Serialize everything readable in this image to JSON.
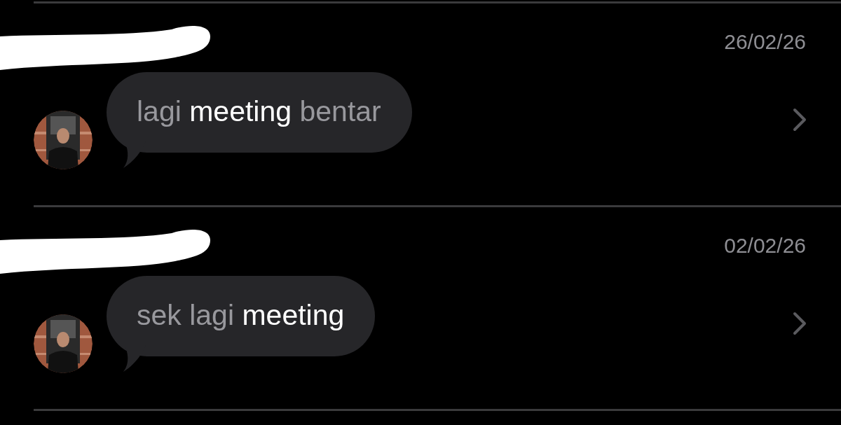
{
  "results": [
    {
      "sender_redacted": true,
      "date": "26/02/26",
      "message": "lagi **meeting** bentar"
    },
    {
      "sender_redacted": true,
      "date": "02/02/26",
      "message": "sek lagi **meeting**"
    }
  ]
}
